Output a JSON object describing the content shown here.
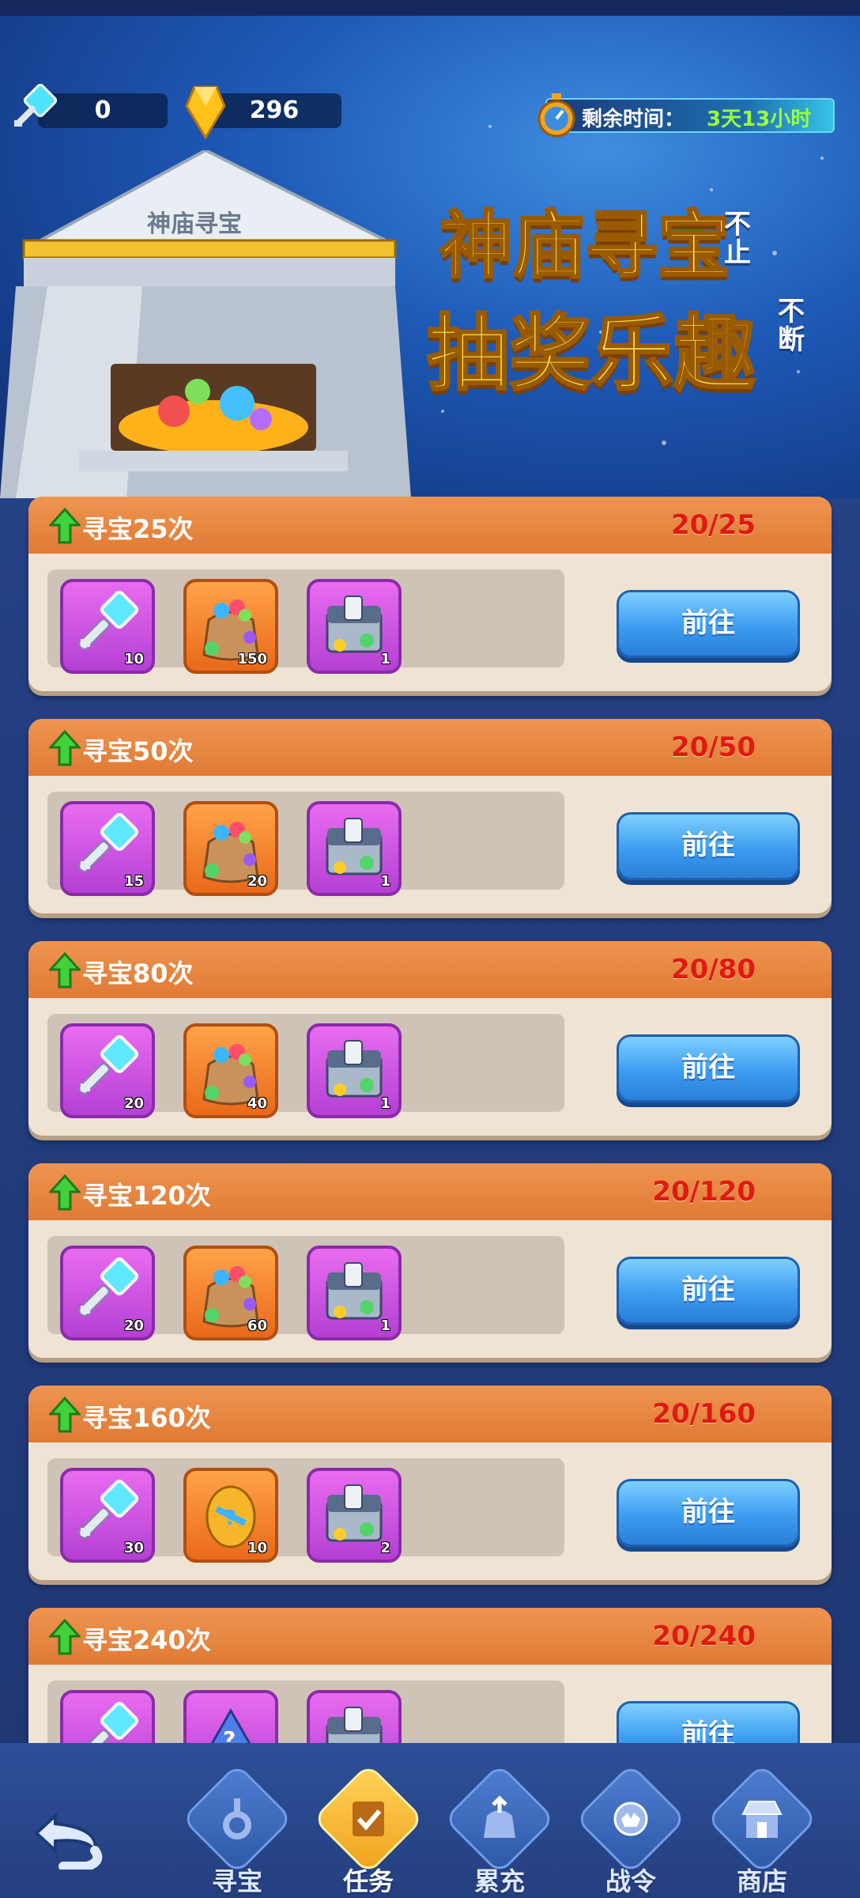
{
  "header": {
    "keys_count": "0",
    "gems_count": "296",
    "timer_label": "剩余时间：",
    "timer_value": "3天13小时"
  },
  "banner": {
    "temple_sign": "神庙寻宝",
    "line1": "神庙寻宝",
    "line1_suffix": "不止",
    "line2": "抽奖乐趣",
    "line2_suffix": "不断"
  },
  "tasks": [
    {
      "title": "寻宝25次",
      "progress": "20/25",
      "button": "前往",
      "rewards": [
        {
          "icon": "key-icon",
          "style": "purple",
          "count": "10"
        },
        {
          "icon": "gem-bag-icon",
          "style": "orange",
          "count": "150"
        },
        {
          "icon": "treasure-chest-icon",
          "style": "purple",
          "count": "1"
        }
      ]
    },
    {
      "title": "寻宝50次",
      "progress": "20/50",
      "button": "前往",
      "rewards": [
        {
          "icon": "key-icon",
          "style": "purple",
          "count": "15"
        },
        {
          "icon": "gem-bag-icon",
          "style": "orange",
          "count": "20"
        },
        {
          "icon": "treasure-chest-icon",
          "style": "purple",
          "count": "1"
        }
      ]
    },
    {
      "title": "寻宝80次",
      "progress": "20/80",
      "button": "前往",
      "rewards": [
        {
          "icon": "key-icon",
          "style": "purple",
          "count": "20"
        },
        {
          "icon": "gem-bag-icon",
          "style": "orange",
          "count": "40"
        },
        {
          "icon": "treasure-chest-icon",
          "style": "purple",
          "count": "1"
        }
      ]
    },
    {
      "title": "寻宝120次",
      "progress": "20/120",
      "button": "前往",
      "rewards": [
        {
          "icon": "key-icon",
          "style": "purple",
          "count": "20"
        },
        {
          "icon": "gem-bag-icon",
          "style": "orange",
          "count": "60"
        },
        {
          "icon": "treasure-chest-icon",
          "style": "purple",
          "count": "1"
        }
      ]
    },
    {
      "title": "寻宝160次",
      "progress": "20/160",
      "button": "前往",
      "rewards": [
        {
          "icon": "key-icon",
          "style": "purple",
          "count": "30"
        },
        {
          "icon": "golden-egg-icon",
          "style": "orange",
          "count": "10"
        },
        {
          "icon": "treasure-chest-icon",
          "style": "purple",
          "count": "2"
        }
      ]
    },
    {
      "title": "寻宝240次",
      "progress": "20/240",
      "button": "前往",
      "rewards": [
        {
          "icon": "key-icon",
          "style": "purple",
          "count": ""
        },
        {
          "icon": "mystery-hat-icon",
          "style": "purple",
          "count": ""
        },
        {
          "icon": "treasure-chest-icon",
          "style": "purple",
          "count": ""
        }
      ]
    }
  ],
  "nav": {
    "back_icon": "back-arrow-icon",
    "items": [
      {
        "label": "寻宝",
        "icon": "key-icon",
        "active": false
      },
      {
        "label": "任务",
        "icon": "task-scroll-icon",
        "active": true
      },
      {
        "label": "累充",
        "icon": "recharge-bag-icon",
        "active": false
      },
      {
        "label": "战令",
        "icon": "battle-pass-icon",
        "active": false
      },
      {
        "label": "商店",
        "icon": "shop-icon",
        "active": false
      }
    ]
  },
  "colors": {
    "accent_orange": "#e07a35",
    "progress_red": "#e01a10",
    "button_blue": "#3c9cf0",
    "timer_green": "#9cff3a"
  }
}
